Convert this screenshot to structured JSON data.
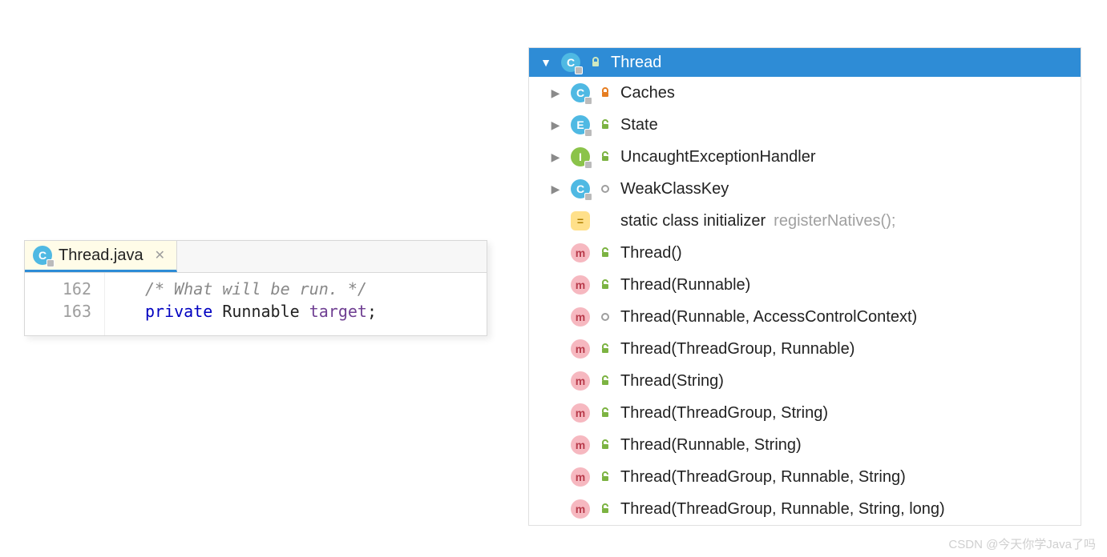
{
  "editor": {
    "tab": {
      "filename": "Thread.java"
    },
    "lines": [
      {
        "num": "162",
        "kind": "comment",
        "text": "/* What will be run. */"
      },
      {
        "num": "163",
        "kind": "field",
        "tokens": {
          "kw": "private",
          "type": "Runnable",
          "name": "target",
          "end": ";"
        }
      }
    ]
  },
  "structure": {
    "header": {
      "name": "Thread",
      "kind": "class",
      "vis": "public"
    },
    "nodes": [
      {
        "kind": "class",
        "vis": "private",
        "arrow": true,
        "name": "Caches"
      },
      {
        "kind": "enum",
        "vis": "public",
        "arrow": true,
        "name": "State"
      },
      {
        "kind": "iface",
        "vis": "public",
        "arrow": true,
        "name": "UncaughtExceptionHandler"
      },
      {
        "kind": "class",
        "vis": "package",
        "arrow": true,
        "name": "WeakClassKey"
      },
      {
        "kind": "static",
        "vis": "",
        "arrow": false,
        "name": "static class initializer",
        "extra": "registerNatives();"
      },
      {
        "kind": "method",
        "vis": "public",
        "arrow": false,
        "name": "Thread()"
      },
      {
        "kind": "method",
        "vis": "public",
        "arrow": false,
        "name": "Thread(Runnable)"
      },
      {
        "kind": "method",
        "vis": "package",
        "arrow": false,
        "name": "Thread(Runnable, AccessControlContext)"
      },
      {
        "kind": "method",
        "vis": "public",
        "arrow": false,
        "name": "Thread(ThreadGroup, Runnable)"
      },
      {
        "kind": "method",
        "vis": "public",
        "arrow": false,
        "name": "Thread(String)"
      },
      {
        "kind": "method",
        "vis": "public",
        "arrow": false,
        "name": "Thread(ThreadGroup, String)"
      },
      {
        "kind": "method",
        "vis": "public",
        "arrow": false,
        "name": "Thread(Runnable, String)"
      },
      {
        "kind": "method",
        "vis": "public",
        "arrow": false,
        "name": "Thread(ThreadGroup, Runnable, String)"
      },
      {
        "kind": "method",
        "vis": "public",
        "arrow": false,
        "name": "Thread(ThreadGroup, Runnable, String, long)"
      }
    ]
  },
  "watermark": "CSDN @今天你学Java了吗",
  "colors": {
    "accent": "#2e8cd6",
    "vis_public": "#7cb342",
    "vis_private": "#e67e22",
    "vis_package": "#9e9e9e"
  }
}
